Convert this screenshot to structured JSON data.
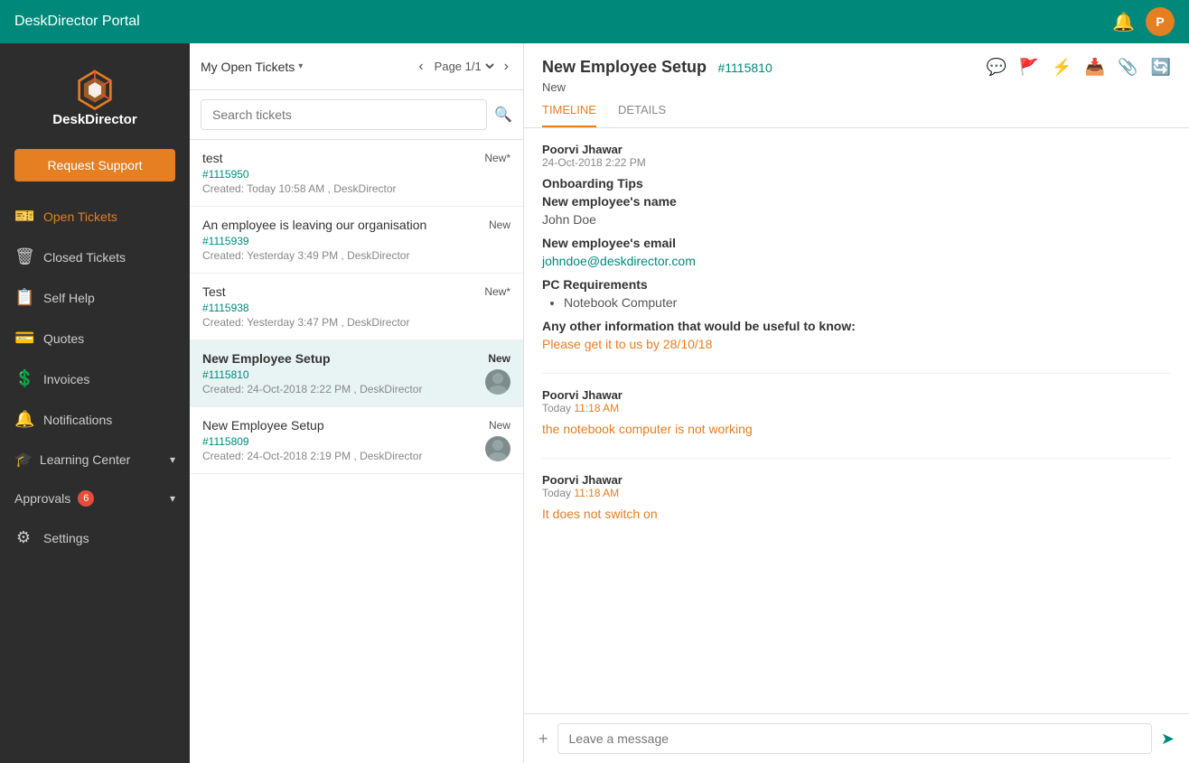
{
  "topnav": {
    "title": "DeskDirector Portal",
    "avatar_letter": "P"
  },
  "sidebar": {
    "logo_text": "DeskDirector",
    "request_btn": "Request Support",
    "items": [
      {
        "id": "open-tickets",
        "label": "Open Tickets",
        "icon": "🎫",
        "active": true
      },
      {
        "id": "closed-tickets",
        "label": "Closed Tickets",
        "icon": "🗑"
      },
      {
        "id": "self-help",
        "label": "Self Help",
        "icon": "📋"
      },
      {
        "id": "quotes",
        "label": "Quotes",
        "icon": "💳"
      },
      {
        "id": "invoices",
        "label": "Invoices",
        "icon": "💲"
      },
      {
        "id": "notifications",
        "label": "Notifications",
        "icon": "🔔"
      }
    ],
    "learning_center": "Learning Center",
    "approvals_label": "Approvals",
    "approvals_badge": "6",
    "settings_label": "Settings"
  },
  "ticket_list": {
    "filter_label": "My Open Tickets",
    "pagination_text": "Page 1/1",
    "search_placeholder": "Search tickets",
    "tickets": [
      {
        "title": "test",
        "status": "New*",
        "id": "#1115950",
        "meta": "Created: Today 10:58 AM , DeskDirector",
        "bold": false,
        "has_avatar": false
      },
      {
        "title": "An employee is leaving our organisation",
        "status": "New",
        "id": "#1115939",
        "meta": "Created: Yesterday 3:49 PM , DeskDirector",
        "bold": false,
        "has_avatar": false
      },
      {
        "title": "Test",
        "status": "New*",
        "id": "#1115938",
        "meta": "Created: Yesterday 3:47 PM , DeskDirector",
        "bold": false,
        "has_avatar": false
      },
      {
        "title": "New Employee Setup",
        "status": "New",
        "id": "#1115810",
        "meta": "Created: 24-Oct-2018 2:22 PM , DeskDirector",
        "bold": true,
        "selected": true,
        "has_avatar": true
      },
      {
        "title": "New Employee Setup",
        "status": "New",
        "id": "#1115809",
        "meta": "Created: 24-Oct-2018 2:19 PM , DeskDirector",
        "bold": false,
        "has_avatar": true
      }
    ]
  },
  "ticket_detail": {
    "title": "New Employee Setup",
    "ticket_id": "#1115810",
    "status": "New",
    "tabs": [
      "TIMELINE",
      "DETAILS"
    ],
    "active_tab": "TIMELINE",
    "timeline": [
      {
        "author": "Poorvi Jhawar",
        "date": "24-Oct-2018 2:22 PM",
        "fields": [
          {
            "label": "Onboarding Tips",
            "value": "",
            "type": "header"
          },
          {
            "label": "New employee's name",
            "value": "John Doe",
            "type": "text"
          },
          {
            "label": "New employee's email",
            "value": "johndoe@deskdirector.com",
            "type": "link"
          },
          {
            "label": "PC Requirements",
            "value": "",
            "type": "header"
          },
          {
            "label": "",
            "value": "Notebook Computer",
            "type": "bullet"
          },
          {
            "label": "Any other information that would be useful to know:",
            "value": "Please get it to us by 28/10/18",
            "type": "urgent"
          }
        ]
      },
      {
        "author": "Poorvi Jhawar",
        "date": "Today 11:18 AM",
        "body": "the notebook computer is not working",
        "type": "comment"
      },
      {
        "author": "Poorvi Jhawar",
        "date": "Today 11:18 AM",
        "body": "It does not switch on",
        "type": "comment"
      }
    ],
    "message_placeholder": "Leave a message"
  },
  "icons": {
    "chat": "💬",
    "flag": "🚩",
    "bolt": "⚡",
    "download": "📥",
    "paperclip": "📎",
    "refresh": "🔄",
    "send": "➤",
    "search": "🔍",
    "bell": "🔔",
    "chevron_down": "▾",
    "chevron_left": "‹",
    "chevron_right": "›",
    "gear": "⚙",
    "plus": "+"
  }
}
